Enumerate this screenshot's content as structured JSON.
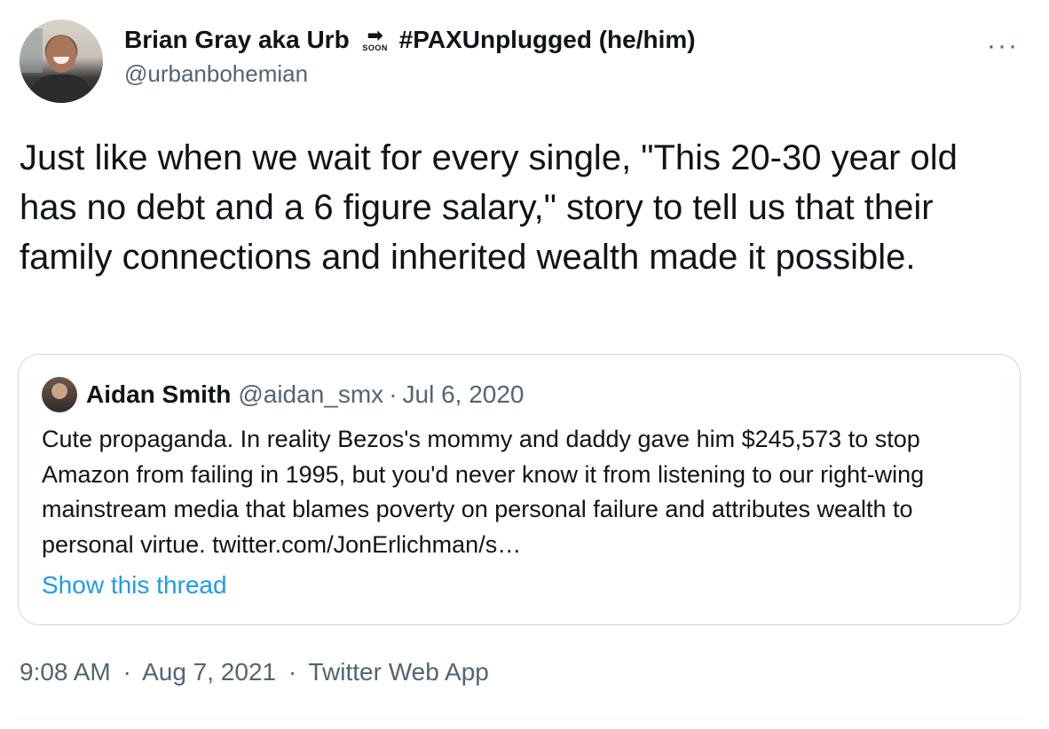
{
  "author": {
    "display_name_prefix": "Brian Gray aka Urb",
    "soon_arrow": "➡",
    "soon_label": "SOON",
    "display_name_suffix": "#PAXUnplugged (he/him)",
    "handle": "@urbanbohemian"
  },
  "more_icon": "···",
  "tweet_text": "Just like when we wait for every single, \"This 20-30 year old has no debt and a 6 figure salary,\" story to tell us that their family connections and inherited wealth made it possible.",
  "quoted_tweet": {
    "name": "Aidan Smith",
    "handle": "@aidan_smx",
    "separator": "·",
    "date": "Jul 6, 2020",
    "text": "Cute propaganda. In reality Bezos's mommy and daddy gave him $245,573 to stop Amazon from failing in 1995, but you'd never know it from listening to our right-wing mainstream media that blames poverty on personal failure and attributes wealth to personal virtue. twitter.com/JonErlichman/s…",
    "show_thread": "Show this thread"
  },
  "meta": {
    "time": "9:08 AM",
    "separator": "·",
    "date": "Aug 7, 2021",
    "source": "Twitter Web App"
  },
  "colors": {
    "text": "#0f1419",
    "secondary": "#536471",
    "link": "#1d9bf0",
    "border": "#cfd9de"
  }
}
